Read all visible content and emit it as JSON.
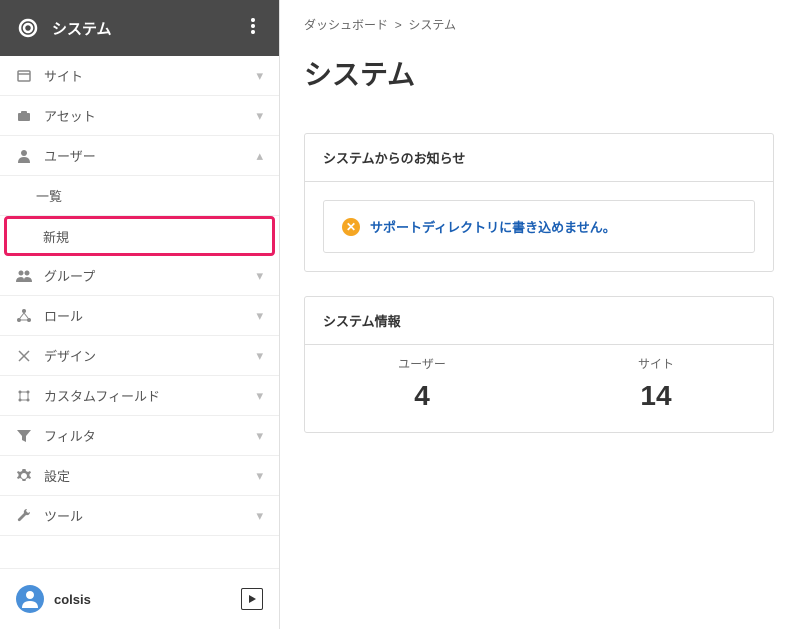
{
  "sidebar": {
    "title": "システム",
    "items": [
      {
        "label": "サイト",
        "icon": "site"
      },
      {
        "label": "アセット",
        "icon": "asset"
      },
      {
        "label": "ユーザー",
        "icon": "user",
        "expanded": true
      },
      {
        "label": "グループ",
        "icon": "group"
      },
      {
        "label": "ロール",
        "icon": "role"
      },
      {
        "label": "デザイン",
        "icon": "design"
      },
      {
        "label": "カスタムフィールド",
        "icon": "field"
      },
      {
        "label": "フィルタ",
        "icon": "filter"
      },
      {
        "label": "設定",
        "icon": "gear"
      },
      {
        "label": "ツール",
        "icon": "wrench"
      }
    ],
    "user_subitems": [
      {
        "label": "一覧"
      },
      {
        "label": "新規",
        "highlighted": true
      }
    ]
  },
  "footer": {
    "username": "colsis"
  },
  "breadcrumb": {
    "root": "ダッシュボード",
    "sep": ">",
    "current": "システム"
  },
  "page": {
    "title": "システム"
  },
  "notice": {
    "header": "システムからのお知らせ",
    "alert_text": "サポートディレクトリに書き込めません。"
  },
  "info": {
    "header": "システム情報",
    "stats": [
      {
        "label": "ユーザー",
        "value": "4"
      },
      {
        "label": "サイト",
        "value": "14"
      }
    ]
  }
}
